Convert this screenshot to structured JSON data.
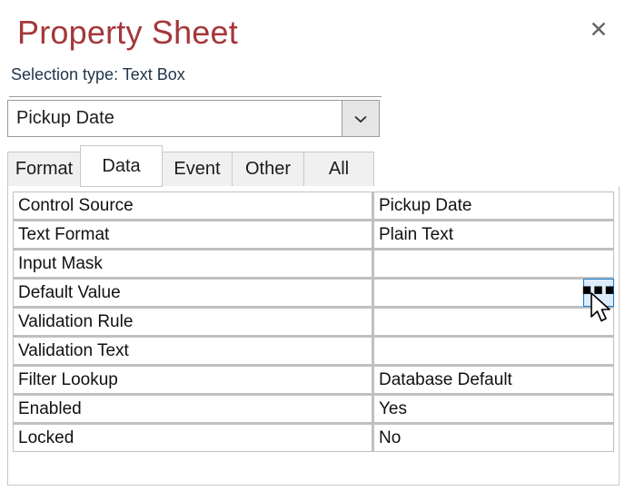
{
  "header": {
    "title": "Property Sheet",
    "selection_type": "Selection type: Text Box",
    "close_icon": "close-icon",
    "title_color": "#A4373A"
  },
  "object_selector": {
    "value": "Pickup Date",
    "arrow_icon": "chevron-down-icon"
  },
  "tabs": [
    {
      "label": "Format",
      "selected": false
    },
    {
      "label": "Data",
      "selected": true
    },
    {
      "label": "Event",
      "selected": false
    },
    {
      "label": "Other",
      "selected": false
    },
    {
      "label": "All",
      "selected": false
    }
  ],
  "properties": [
    {
      "name": "Control Source",
      "value": "Pickup Date",
      "builder": false
    },
    {
      "name": "Text Format",
      "value": "Plain Text",
      "builder": false
    },
    {
      "name": "Input Mask",
      "value": "",
      "builder": false
    },
    {
      "name": "Default Value",
      "value": "",
      "builder": true,
      "builder_label": "▪▪▪"
    },
    {
      "name": "Validation Rule",
      "value": "",
      "builder": false
    },
    {
      "name": "Validation Text",
      "value": "",
      "builder": false
    },
    {
      "name": "Filter Lookup",
      "value": "Database Default",
      "builder": false
    },
    {
      "name": "Enabled",
      "value": "Yes",
      "builder": false
    },
    {
      "name": "Locked",
      "value": "No",
      "builder": false
    }
  ],
  "colors": {
    "accent_blue": "#0d7ad4",
    "builder_fill": "#ddecfa",
    "grid_line": "#bfbfbf",
    "tab_inactive": "#f0f0f0"
  }
}
